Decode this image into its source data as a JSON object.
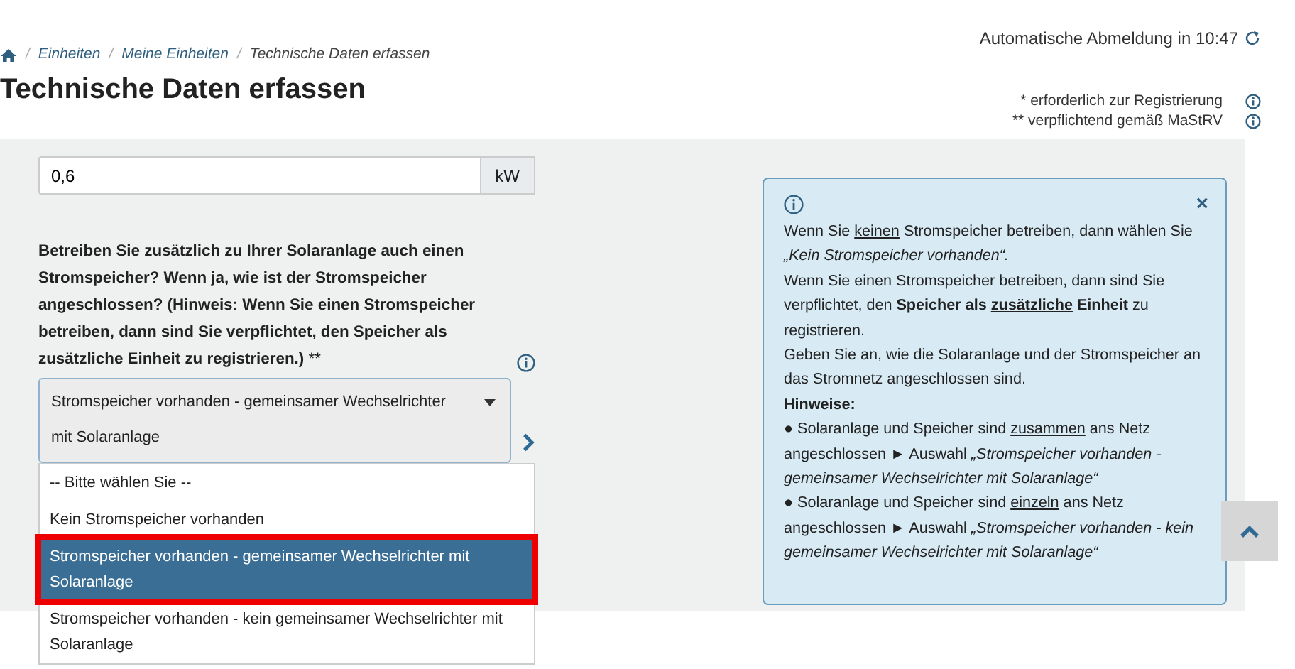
{
  "session": {
    "text": "Automatische Abmeldung in 10:47"
  },
  "breadcrumb": [
    {
      "separator": "/",
      "label": "Einheiten",
      "kind": "link"
    },
    {
      "separator": "/",
      "label": "Meine Einheiten",
      "kind": "link"
    },
    {
      "separator": "/",
      "label": "Technische Daten erfassen",
      "kind": "current"
    }
  ],
  "page_title": "Technische Daten erfassen",
  "legend": [
    {
      "text": "* erforderlich zur Registrierung"
    },
    {
      "text": "** verpflichtend gemäß MaStRV"
    }
  ],
  "power_field": {
    "value": "0,6",
    "unit": "kW"
  },
  "storage_question": {
    "label": "Betreiben Sie zusätzlich zu Ihrer Solaranlage auch einen Stromspeicher? Wenn ja, wie ist der Stromspeicher angeschlossen? (Hinweis: Wenn Sie einen Stromspeicher betreiben, dann sind Sie verpflichtet, den Speicher als zusätzliche Einheit zu registrieren.)",
    "required_mark": "**",
    "value": "Stromspeicher vorhanden - gemeinsamer Wechselrichter mit Solaranlage",
    "expanded": true,
    "options": [
      {
        "label": "-- Bitte wählen Sie --",
        "selected": false,
        "marked": false
      },
      {
        "label": "Kein Stromspeicher vorhanden",
        "selected": false,
        "marked": false
      },
      {
        "label": "Stromspeicher vorhanden - gemeinsamer Wechselrichter mit Solaranlage",
        "selected": true,
        "marked": true
      },
      {
        "label": "Stromspeicher vorhanden - kein gemeinsamer Wechselrichter mit Solaranlage",
        "selected": false,
        "marked": false
      }
    ]
  },
  "info_box": {
    "close": "×",
    "paragraphs": [
      [
        {
          "text": "Wenn Sie ",
          "kind": "plain"
        },
        {
          "text": "keinen",
          "kind": "underlined"
        },
        {
          "text": " Stromspeicher betreiben, dann wählen Sie ",
          "kind": "plain"
        },
        {
          "text": "„Kein Stromspeicher vorhanden“.",
          "kind": "quote"
        }
      ],
      [
        {
          "text": "Wenn Sie einen Stromspeicher betreiben, dann sind Sie verpflichtet, den ",
          "kind": "plain"
        },
        {
          "text": "Speicher als ",
          "kind": "strong"
        },
        {
          "text": "zusätzliche",
          "kind": "strong-underlined"
        },
        {
          "text": " Einheit",
          "kind": "strong"
        },
        {
          "text": " zu registrieren.",
          "kind": "plain"
        }
      ],
      [
        {
          "text": "Geben Sie an, wie die Solaranlage und der Stromspeicher an das Stromnetz angeschlossen sind.",
          "kind": "plain"
        }
      ],
      [
        {
          "text": "Hinweise:",
          "kind": "strong"
        }
      ],
      [
        {
          "text": "● Solaranlage und Speicher sind ",
          "kind": "plain"
        },
        {
          "text": "zusammen",
          "kind": "underlined"
        },
        {
          "text": " ans Netz angeschlossen ► Auswahl ",
          "kind": "plain"
        },
        {
          "text": "„Stromspeicher vorhanden - gemeinsamer Wechselrichter mit Solaranlage“",
          "kind": "quote"
        }
      ],
      [
        {
          "text": "● Solaranlage und Speicher sind ",
          "kind": "plain"
        },
        {
          "text": "einzeln",
          "kind": "underlined"
        },
        {
          "text": " ans Netz angeschlossen ► Auswahl ",
          "kind": "plain"
        },
        {
          "text": "„Stromspeicher vorhanden - kein gemeinsamer Wechselrichter mit Solaranlage“",
          "kind": "quote"
        }
      ]
    ]
  }
}
